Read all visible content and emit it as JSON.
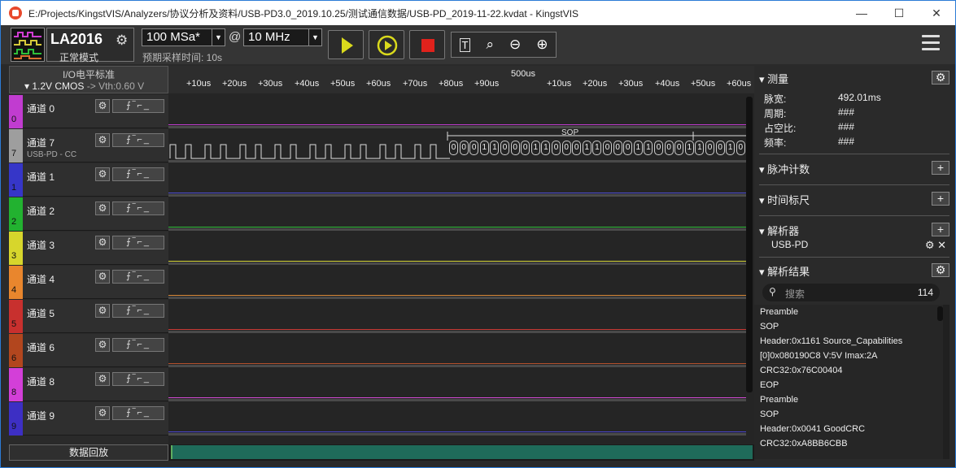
{
  "window": {
    "title": "E:/Projects/KingstVIS/Analyzers/协议分析及资料/USB-PD3.0_2019.10.25/测试通信数据/USB-PD_2019-11-22.kvdat - KingstVIS",
    "minimize": "—",
    "maximize": "☐",
    "close": "✕"
  },
  "toolbar": {
    "device": "LA2016",
    "mode": "正常模式",
    "sample_rate": "100 MSa*",
    "at": "@",
    "frequency": "10 MHz",
    "estimate": "预期采样时间: 10s",
    "tools": [
      "T",
      "🔍",
      "−",
      "+"
    ]
  },
  "io": {
    "title": "I/O电平标准",
    "standard": "▾ 1.2V CMOS",
    "vth": "-> Vth:0.60 V"
  },
  "channels": [
    {
      "num": "0",
      "name": "通道 0",
      "sub": "",
      "color": "#c13cd0",
      "line": "#c13cd0"
    },
    {
      "num": "7",
      "name": "通道 7",
      "sub": "USB-PD - CC",
      "color": "#9e9e9e",
      "line": "#bbbbbb"
    },
    {
      "num": "1",
      "name": "通道 1",
      "sub": "",
      "color": "#3636c8",
      "line": "#5050d8"
    },
    {
      "num": "2",
      "name": "通道 2",
      "sub": "",
      "color": "#22b230",
      "line": "#2fbf3a"
    },
    {
      "num": "3",
      "name": "通道 3",
      "sub": "",
      "color": "#d7d62c",
      "line": "#d6d63a"
    },
    {
      "num": "4",
      "name": "通道 4",
      "sub": "",
      "color": "#e9862d",
      "line": "#d98a3a"
    },
    {
      "num": "5",
      "name": "通道 5",
      "sub": "",
      "color": "#c8302e",
      "line": "#c83a36"
    },
    {
      "num": "6",
      "name": "通道 6",
      "sub": "",
      "color": "#b2461e",
      "line": "#b4502c"
    },
    {
      "num": "8",
      "name": "通道 8",
      "sub": "",
      "color": "#d33fd8",
      "line": "#d44ad6"
    },
    {
      "num": "9",
      "name": "通道 9",
      "sub": "",
      "color": "#3d2fc4",
      "line": "#4a44d0"
    }
  ],
  "channel_controls": {
    "gear": "⚙",
    "trigger": "⨍‾⌐_"
  },
  "replay": "数据回放",
  "ruler": {
    "center": "500us",
    "ticks": [
      "+10us",
      "+20us",
      "+30us",
      "+40us",
      "+50us",
      "+60us",
      "+70us",
      "+80us",
      "+90us",
      "+10us",
      "+20us",
      "+30us",
      "+40us",
      "+50us",
      "+60us"
    ]
  },
  "decode": {
    "label": "SOP",
    "bits": [
      "0",
      "0",
      "0",
      "1",
      "1",
      "0",
      "0",
      "0",
      "1",
      "1",
      "0",
      "0",
      "0",
      "1",
      "1",
      "0",
      "0",
      "0",
      "1",
      "1",
      "0",
      "0",
      "0",
      "1",
      "1",
      "0",
      "0",
      "1",
      "0"
    ]
  },
  "right_panel": {
    "measure": {
      "title": "测量",
      "rows": [
        {
          "label": "脉宽:",
          "value": "492.01ms"
        },
        {
          "label": "周期:",
          "value": "###"
        },
        {
          "label": "占空比:",
          "value": "###"
        },
        {
          "label": "频率:",
          "value": "###"
        }
      ]
    },
    "pulse_count": "脉冲计数",
    "time_ruler": "时间标尺",
    "analyzer": {
      "title": "解析器",
      "item": "USB-PD"
    },
    "results": {
      "title": "解析结果",
      "search_placeholder": "搜索",
      "count": "114",
      "items": [
        "Preamble",
        "SOP",
        "Header:0x1161 Source_Capabilities",
        "[0]0x080190C8 V:5V Imax:2A",
        "CRC32:0x76C00404",
        "EOP",
        "Preamble",
        "SOP",
        "Header:0x0041 GoodCRC",
        "CRC32:0xA8BB6CBB"
      ]
    }
  }
}
